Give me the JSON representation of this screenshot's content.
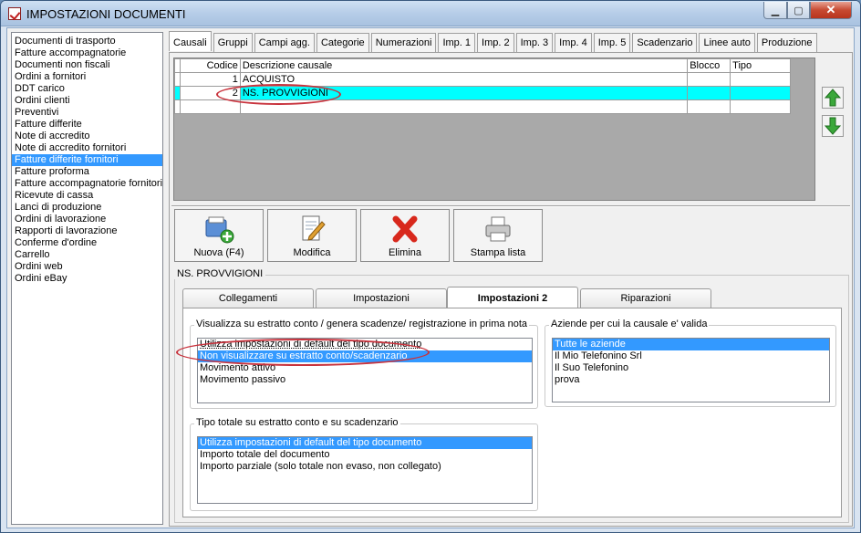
{
  "window": {
    "title": "IMPOSTAZIONI DOCUMENTI",
    "close_glyph": "✕",
    "min_glyph": "▁",
    "max_glyph": "▢"
  },
  "doc_types": [
    "Documenti di trasporto",
    "Fatture accompagnatorie",
    "Documenti non fiscali",
    "Ordini a fornitori",
    "DDT carico",
    "Ordini clienti",
    "Preventivi",
    "Fatture differite",
    "Note di accredito",
    "Note di accredito fornitori",
    "Fatture differite fornitori",
    "Fatture proforma",
    "Fatture accompagnatorie fornitori",
    "Ricevute di cassa",
    "Lanci di produzione",
    "Ordini di lavorazione",
    "Rapporti di lavorazione",
    "Conferme d'ordine",
    "Carrello",
    "Ordini web",
    "Ordini eBay"
  ],
  "selected_doc_type": "Fatture differite fornitori",
  "tabs": [
    "Causali",
    "Gruppi",
    "Campi agg.",
    "Categorie",
    "Numerazioni",
    "Imp. 1",
    "Imp. 2",
    "Imp. 3",
    "Imp. 4",
    "Imp. 5",
    "Scadenzario",
    "Linee auto",
    "Produzione"
  ],
  "active_tab": "Causali",
  "grid": {
    "headers": [
      "Codice",
      "Descrizione causale",
      "Blocco",
      "Tipo"
    ],
    "rows": [
      {
        "code": "1",
        "desc": "ACQUISTO",
        "blocco": "",
        "tipo": ""
      },
      {
        "code": "2",
        "desc": "NS. PROVVIGIONI",
        "blocco": "",
        "tipo": ""
      },
      {
        "code": "",
        "desc": "",
        "blocco": "",
        "tipo": ""
      }
    ],
    "selected_row": 1
  },
  "toolbar": {
    "new": "Nuova (F4)",
    "edit": "Modifica",
    "delete": "Elimina",
    "print": "Stampa lista"
  },
  "section_title": "NS. PROVVIGIONI",
  "subtabs": [
    "Collegamenti",
    "Impostazioni",
    "Impostazioni 2",
    "Riparazioni"
  ],
  "active_subtab": "Impostazioni 2",
  "visualizza": {
    "title": "Visualizza su estratto conto / genera scadenze/ registrazione  in prima nota",
    "options": [
      "Utilizza impostazioni di default del tipo documento",
      "Non visualizzare su estratto conto/scadenzario",
      "Movimento attivo",
      "Movimento passivo"
    ],
    "selected": "Non visualizzare su estratto conto/scadenzario"
  },
  "aziende": {
    "title": "Aziende per cui la causale e' valida",
    "options": [
      "Tutte le aziende",
      "Il Mio Telefonino Srl",
      "Il Suo Telefonino",
      "prova"
    ],
    "selected": "Tutte le aziende"
  },
  "tipo_totale": {
    "title": "Tipo totale su estratto conto e su scadenzario",
    "options": [
      "Utilizza impostazioni di default del tipo documento",
      "Importo totale del documento",
      "Importo parziale (solo totale non evaso, non collegato)"
    ],
    "selected": "Utilizza impostazioni di default del tipo documento"
  },
  "colors": {
    "accent": "#3399ff",
    "row_highlight": "#00ffff",
    "annotation_ring": "#c8323c",
    "arrow_green": "#3aa83a"
  }
}
